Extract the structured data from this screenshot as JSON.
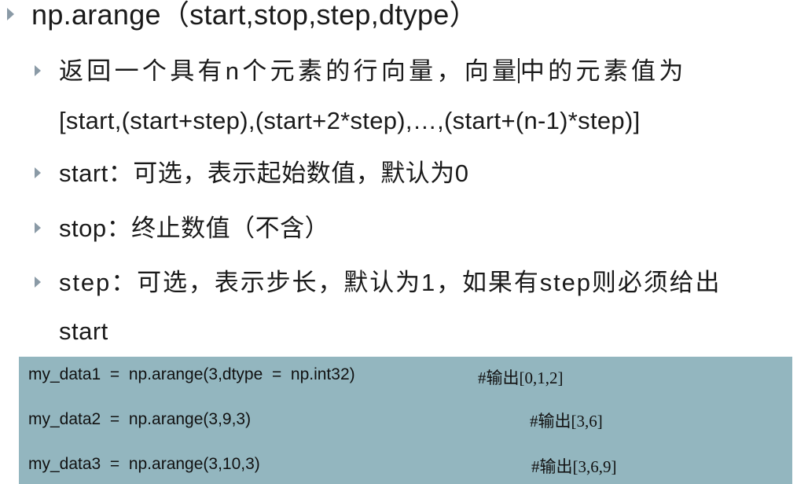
{
  "title": "np.arange（start,stop,step,dtype）",
  "bullets": [
    {
      "line1": "返回一个具有n个元素的行向量，向量",
      "line1_after_caret": "中的元素值为",
      "line2": "[start,(start+step),(start+2*step),…,(start+(n-1)*step)]"
    },
    {
      "line1": "start：可选，表示起始数值，默认为0"
    },
    {
      "line1": "stop：终止数值（不含）"
    },
    {
      "line1": "step：可选，表示步长，默认为1，如果有step则必须给出",
      "line2": "start"
    }
  ],
  "code": [
    {
      "code": "my_data1  =  np.arange(3,dtype  =  np.int32)",
      "comment": "#输出[0,1,2]"
    },
    {
      "code": "my_data2  =  np.arange(3,9,3)",
      "comment": "#输出[3,6]"
    },
    {
      "code": "my_data3  =  np.arange(3,10,3)",
      "comment": "#输出[3,6,9]"
    }
  ],
  "colors": {
    "bullet": "#8a9aa6",
    "code_background": "#93b6bf",
    "text": "#1a1a1a"
  }
}
